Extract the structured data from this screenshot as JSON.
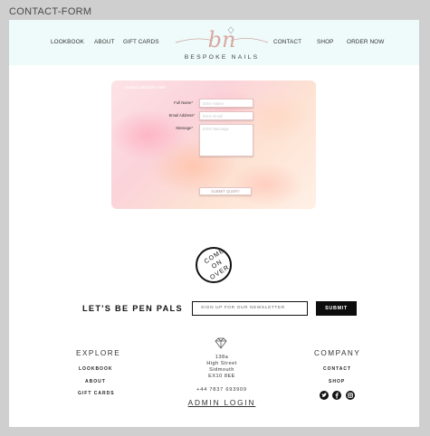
{
  "page": {
    "label": "CONTACT-FORM"
  },
  "header": {
    "nav_left": [
      "LOOKBOOK",
      "ABOUT",
      "GIFT CARDS"
    ],
    "nav_right": [
      "CONTACT",
      "SHOP",
      "ORDER NOW"
    ],
    "logo": {
      "monogram": "bn",
      "text": "BESPOKE NAILS"
    }
  },
  "contact_form": {
    "title": "Contact Bespoke Nails",
    "full_name": {
      "label": "Full Name*",
      "placeholder": "Enter Name"
    },
    "email": {
      "label": "Email Address*",
      "placeholder": "Enter Email"
    },
    "message": {
      "label": "Message*",
      "placeholder": "Enter Message"
    },
    "submit": "SUBMIT QUERY"
  },
  "badge": {
    "lines": [
      "COME",
      "ON",
      "OVER"
    ]
  },
  "newsletter": {
    "heading": "LET'S BE PEN PALS",
    "placeholder": "SIGN UP FOR OUR NEWSLETTER",
    "button": "SUBMIT"
  },
  "footer": {
    "explore": {
      "heading": "EXPLORE",
      "links": [
        "LOOKBOOK",
        "ABOUT",
        "GIFT CARDS"
      ]
    },
    "address": [
      "138a",
      "High Street",
      "Sidmouth",
      "EX10 8EE"
    ],
    "phone": "+44 7837 693909",
    "admin_login": "ADMIN LOGIN",
    "company": {
      "heading": "COMPANY",
      "links": [
        "CONTACT",
        "SHOP"
      ]
    },
    "social_icons": [
      "twitter-icon",
      "facebook-icon",
      "instagram-icon"
    ]
  }
}
